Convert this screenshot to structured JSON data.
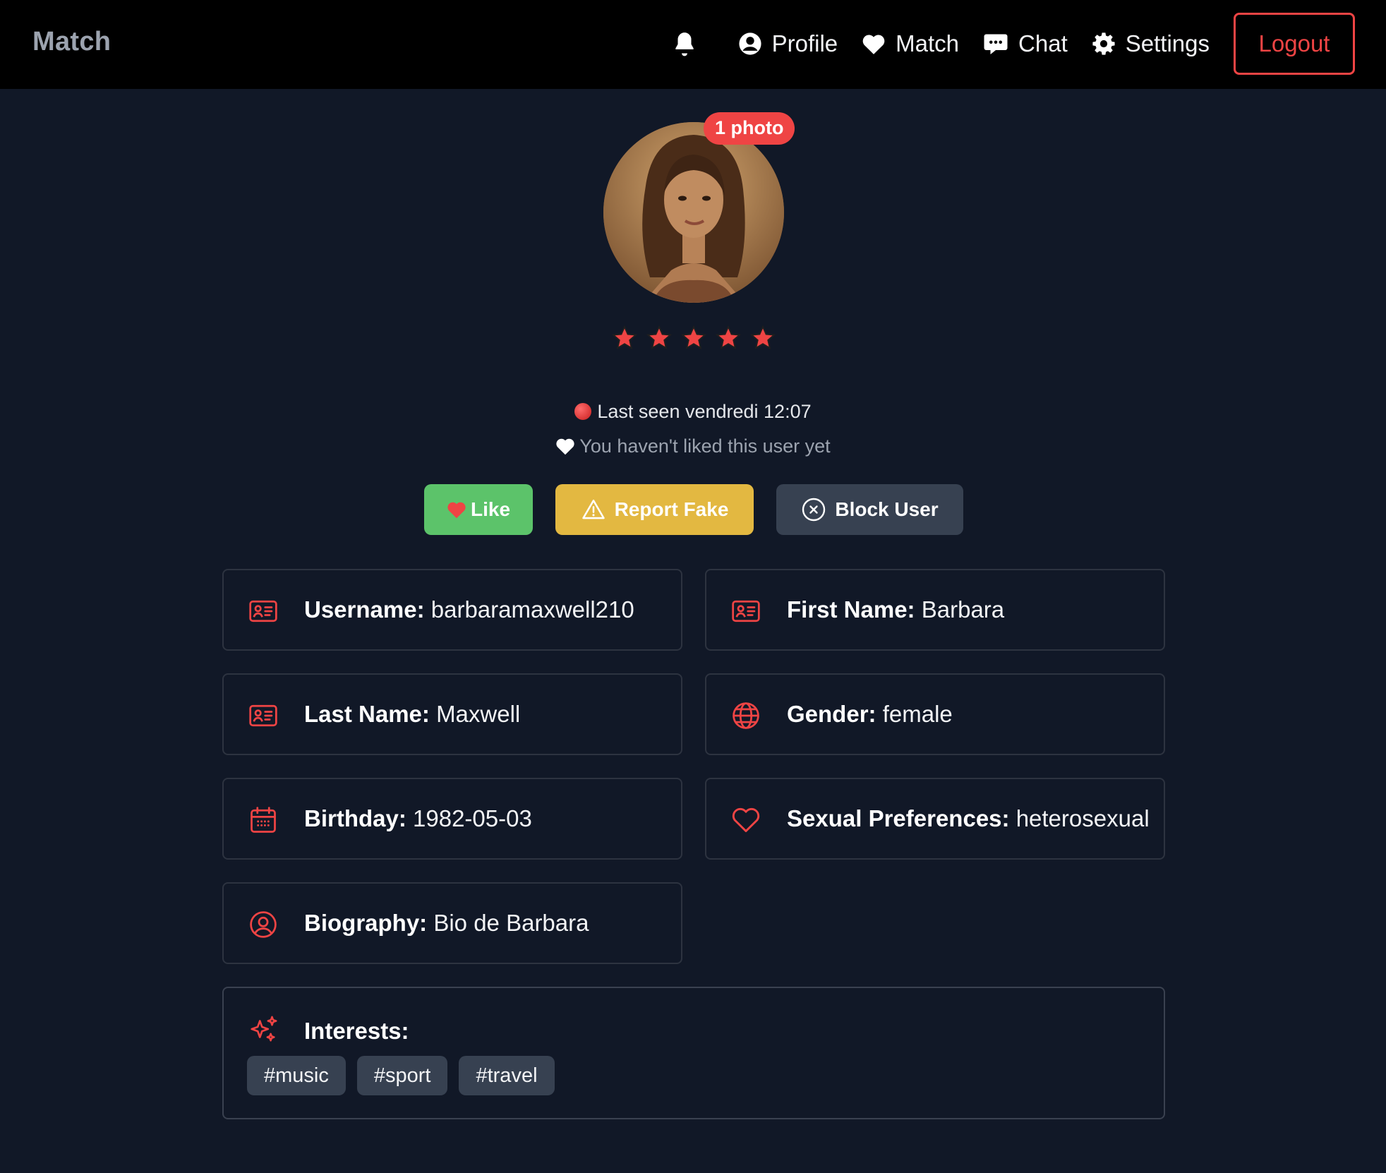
{
  "navbar": {
    "brand": "Match",
    "items": [
      {
        "label": "Profile",
        "icon": "user-circle-icon"
      },
      {
        "label": "Match",
        "icon": "heart-icon"
      },
      {
        "label": "Chat",
        "icon": "chat-bubble-icon"
      },
      {
        "label": "Settings",
        "icon": "gear-icon"
      }
    ],
    "logout_label": "Logout"
  },
  "profile": {
    "photo_badge": "1 photo",
    "rating": 5,
    "rating_max": 5,
    "last_seen": "Last seen vendredi 12:07",
    "like_status": "You haven't liked this user yet"
  },
  "actions": {
    "like_label": "Like",
    "report_label": "Report Fake",
    "block_label": "Block User"
  },
  "fields": {
    "username": {
      "label": "Username:",
      "value": "barbaramaxwell210"
    },
    "first_name": {
      "label": "First Name:",
      "value": "Barbara"
    },
    "last_name": {
      "label": "Last Name:",
      "value": "Maxwell"
    },
    "gender": {
      "label": "Gender:",
      "value": "female"
    },
    "birthday": {
      "label": "Birthday:",
      "value": "1982-05-03"
    },
    "sexual_preferences": {
      "label": "Sexual Preferences:",
      "value": "heterosexual"
    },
    "biography": {
      "label": "Biography:",
      "value": "Bio de Barbara"
    }
  },
  "interests": {
    "title": "Interests:",
    "tags": [
      "#music",
      "#sport",
      "#travel"
    ]
  },
  "colors": {
    "accent": "#ef4444",
    "like": "#5cc36a",
    "report": "#e3b841",
    "block": "#374151",
    "background": "#111827"
  }
}
